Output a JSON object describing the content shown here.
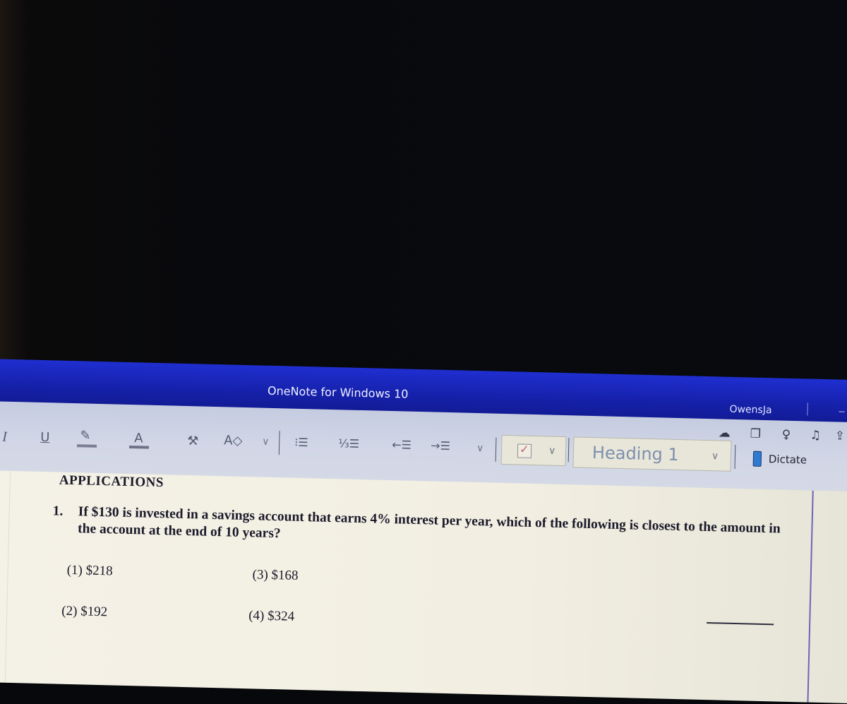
{
  "window": {
    "app_title": "OneNote for Windows 10",
    "user_name": "OwensJa"
  },
  "ribbon": {
    "format_buttons": [
      {
        "name": "italic",
        "glyph": "I"
      },
      {
        "name": "underline",
        "glyph": "U"
      },
      {
        "name": "highlight",
        "glyph": "✎"
      },
      {
        "name": "font-color",
        "glyph": "A"
      },
      {
        "name": "format-painter",
        "glyph": "⌖"
      },
      {
        "name": "clear-formatting",
        "glyph": "A◇"
      }
    ],
    "list_buttons": [
      {
        "name": "bullets",
        "glyph": "⁝☰"
      },
      {
        "name": "numbering",
        "glyph": "⅓☰"
      },
      {
        "name": "outdent",
        "glyph": "←☰"
      },
      {
        "name": "indent",
        "glyph": "→☰"
      }
    ],
    "tag_checkbox_glyph": "✓",
    "style_selected": "Heading 1",
    "dictate_label": "Dictate",
    "chevron_glyph": "⌄",
    "status_icons": [
      {
        "name": "sync-cloud",
        "glyph": "☁"
      },
      {
        "name": "page-copy",
        "glyph": "❐"
      },
      {
        "name": "lightbulb",
        "glyph": "💡"
      },
      {
        "name": "bell",
        "glyph": "🔔"
      },
      {
        "name": "share",
        "glyph": "⇪"
      }
    ]
  },
  "page": {
    "heading": "APPLICATIONS",
    "question": {
      "number": "1.",
      "text": "If $130 is invested in a savings account that earns 4% interest per year, which of the following is closest to the amount in the account at the end of 10 years?"
    },
    "choices": [
      {
        "label": "(1) $218"
      },
      {
        "label": "(2) $192"
      },
      {
        "label": "(3) $168"
      },
      {
        "label": "(4) $324"
      }
    ]
  },
  "colors": {
    "titlebar": "#1a26b8",
    "ribbon": "#cfd4e4",
    "page": "#f2efe2"
  }
}
